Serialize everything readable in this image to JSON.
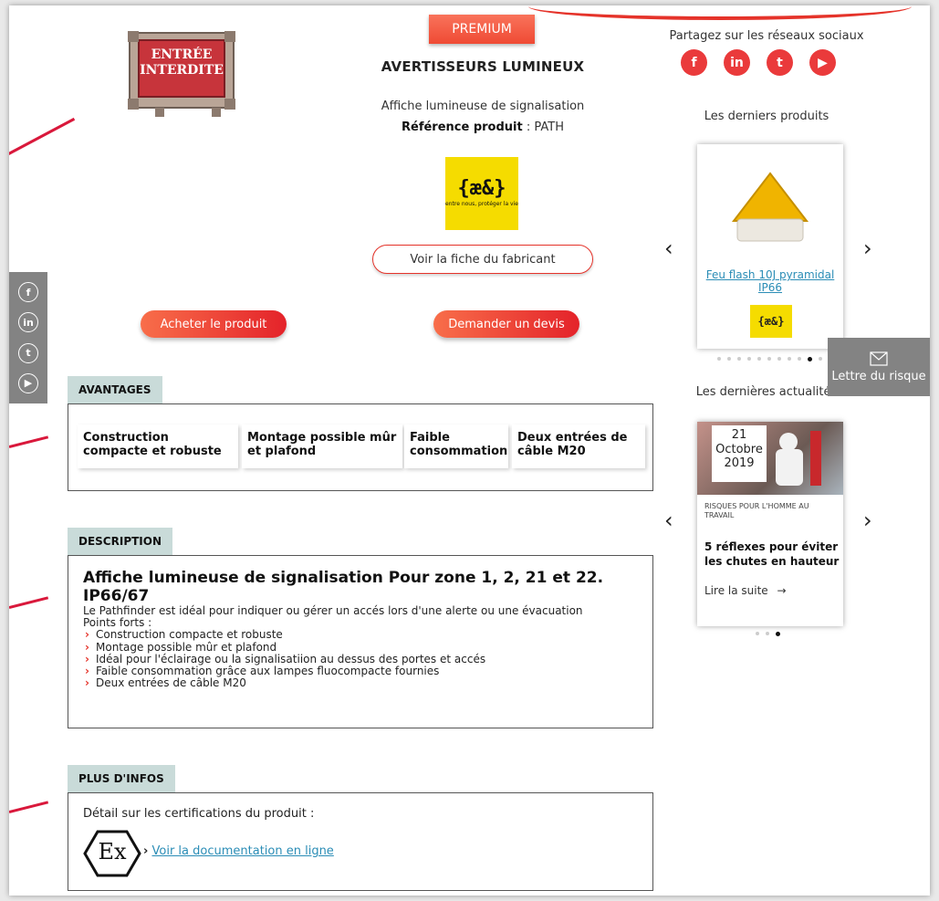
{
  "premium_badge": "PREMIUM",
  "product": {
    "image_text_line1": "ENTRÉE",
    "image_text_line2": "INTERDITE",
    "title": "AVERTISSEURS LUMINEUX",
    "subtitle": "Affiche lumineuse de signalisation",
    "ref_label": "Référence produit",
    "ref_value": " : PATH",
    "maker_logo_text": "{æ&}",
    "maker_logo_tagline": "entre nous, protéger la vie",
    "maker_button": "Voir la fiche du fabricant",
    "buy_button": "Acheter le produit",
    "quote_button": "Demander un devis"
  },
  "advantages": {
    "tab": "AVANTAGES",
    "items": [
      "Construction compacte et robuste",
      "Montage possible mûr et plafond",
      "Faible consommation",
      "Deux entrées de câble M20"
    ]
  },
  "description": {
    "tab": "DESCRIPTION",
    "heading": "Affiche lumineuse de signalisation Pour zone 1, 2, 21 et 22. IP66/67",
    "text": "Le Pathfinder est idéal pour indiquer ou gérer un accés lors d'une alerte ou une évacuation",
    "points_label": "Points forts :",
    "points": [
      "Construction compacte et robuste",
      "Montage possible mûr et plafond",
      "Idéal pour l'éclairage ou la signalisatiion au dessus des portes et accés",
      "Faible consommation grâce aux lampes fluocompacte fournies",
      "Deux entrées de câble M20"
    ]
  },
  "more_info": {
    "tab": "PLUS D'INFOS",
    "label": "Détail sur les certifications du produit :",
    "ex_symbol": "Ex",
    "doc_link": "Voir la documentation en ligne"
  },
  "sidebar": {
    "share_title": "Partagez sur les réseaux sociaux",
    "share_icons": [
      "facebook-icon",
      "linkedin-icon",
      "twitter-icon",
      "youtube-icon"
    ],
    "latest_products_title": "Les derniers produits",
    "product_card": {
      "name": "Feu flash 10J pyramidal IP66",
      "logo_text": "{æ&}"
    },
    "latest_news_title": "Les dernières actualités",
    "news_card": {
      "day": "21",
      "month": "Octobre",
      "year": "2019",
      "category": "RISQUES POUR L'HOMME AU TRAVAIL",
      "title": "5 réflexes pour éviter les chutes en hauteur",
      "read_more": "Lire la suite"
    }
  },
  "letter_button": "Lettre du risque",
  "colors": {
    "accent": "#e5332a",
    "tab_bg": "#c9dbd9",
    "link": "#2b8db6",
    "logo_yellow": "#f5dc00"
  }
}
